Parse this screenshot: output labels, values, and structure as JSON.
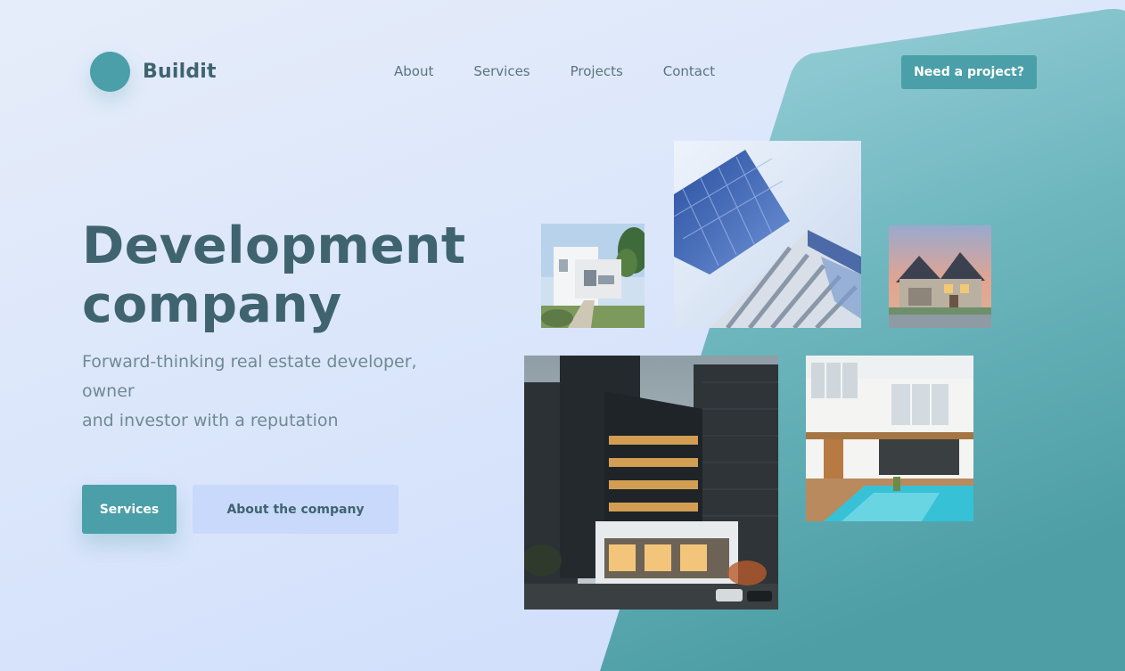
{
  "brand": {
    "name": "Buildit"
  },
  "nav": {
    "items": [
      {
        "label": "About"
      },
      {
        "label": "Services"
      },
      {
        "label": "Projects"
      },
      {
        "label": "Contact"
      }
    ],
    "cta_label": "Need a project?"
  },
  "hero": {
    "title_line1": "Development",
    "title_line2": "company",
    "subtitle_line1": "Forward-thinking real estate developer, owner",
    "subtitle_line2": "and investor with a reputation",
    "primary_button": "Services",
    "secondary_button": "About the company"
  },
  "gallery": {
    "photos": [
      {
        "name": "white-modern-house"
      },
      {
        "name": "glass-tower"
      },
      {
        "name": "suburban-house"
      },
      {
        "name": "office-building"
      },
      {
        "name": "villa-with-pool"
      }
    ]
  },
  "colors": {
    "accent": "#4a9fa8",
    "text_dark": "#3f6470",
    "text_muted": "#6f8a93",
    "secondary_button": "#c9d9fb",
    "background": "#dbe6fb"
  }
}
